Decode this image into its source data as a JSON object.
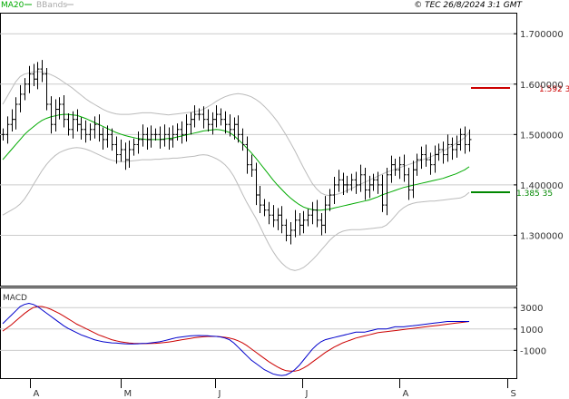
{
  "header": {
    "legend": [
      {
        "label": "MA20",
        "color": "#00aa00"
      },
      {
        "label": "BBands",
        "color": "#aaaaaa"
      }
    ],
    "copyright": "© TEC 26/8/2024 3:1 GMT"
  },
  "colors": {
    "price": "#000000",
    "ma20": "#00aa00",
    "bbands": "#bbbbbb",
    "resistance": "#cc0000",
    "support": "#008800",
    "macd": "#0000cc",
    "signal": "#cc0000",
    "grid": "#cccccc"
  },
  "chart_data": [
    {
      "type": "line",
      "title": "",
      "y_ticks": [
        "1.700000",
        "1.600000",
        "1.500000",
        "1.400000",
        "1.300000"
      ],
      "ylim": [
        1.2,
        1.74
      ],
      "x_ticks": [
        "A",
        "M",
        "J",
        "J",
        "A",
        "S"
      ],
      "levels": [
        {
          "name": "resistance",
          "value": 1.5923,
          "label": "1.592 3",
          "color": "#cc0000"
        },
        {
          "name": "support",
          "value": 1.38535,
          "label": "1.385 35",
          "color": "#008800"
        }
      ],
      "series": [
        {
          "key": "close",
          "values": [
            1.5,
            1.52,
            1.53,
            1.56,
            1.58,
            1.6,
            1.62,
            1.61,
            1.63,
            1.62,
            1.56,
            1.52,
            1.55,
            1.56,
            1.53,
            1.51,
            1.53,
            1.52,
            1.51,
            1.5,
            1.51,
            1.52,
            1.5,
            1.49,
            1.5,
            1.48,
            1.46,
            1.47,
            1.45,
            1.47,
            1.48,
            1.49,
            1.5,
            1.49,
            1.5,
            1.5,
            1.49,
            1.5,
            1.49,
            1.5,
            1.51,
            1.5,
            1.52,
            1.53,
            1.54,
            1.54,
            1.53,
            1.52,
            1.53,
            1.54,
            1.53,
            1.52,
            1.51,
            1.52,
            1.5,
            1.48,
            1.44,
            1.43,
            1.38,
            1.36,
            1.35,
            1.34,
            1.33,
            1.34,
            1.32,
            1.3,
            1.31,
            1.33,
            1.32,
            1.33,
            1.34,
            1.35,
            1.33,
            1.32,
            1.36,
            1.38,
            1.4,
            1.41,
            1.4,
            1.4,
            1.41,
            1.4,
            1.42,
            1.39,
            1.4,
            1.41,
            1.4,
            1.36,
            1.42,
            1.44,
            1.43,
            1.44,
            1.42,
            1.39,
            1.43,
            1.45,
            1.46,
            1.45,
            1.44,
            1.46,
            1.47,
            1.46,
            1.48,
            1.47,
            1.48,
            1.5,
            1.48,
            1.49
          ]
        },
        {
          "key": "ma20",
          "values": [
            1.45,
            1.46,
            1.47,
            1.48,
            1.49,
            1.5,
            1.508,
            1.515,
            1.522,
            1.528,
            1.532,
            1.535,
            1.537,
            1.539,
            1.54,
            1.54,
            1.539,
            1.538,
            1.535,
            1.532,
            1.528,
            1.524,
            1.52,
            1.516,
            1.512,
            1.508,
            1.504,
            1.501,
            1.498,
            1.496,
            1.494,
            1.492,
            1.491,
            1.49,
            1.49,
            1.49,
            1.49,
            1.491,
            1.492,
            1.493,
            1.495,
            1.497,
            1.499,
            1.501,
            1.503,
            1.505,
            1.507,
            1.508,
            1.509,
            1.51,
            1.509,
            1.507,
            1.504,
            1.498,
            1.49,
            1.482,
            1.473,
            1.464,
            1.454,
            1.443,
            1.432,
            1.421,
            1.41,
            1.4,
            1.391,
            1.382,
            1.374,
            1.367,
            1.361,
            1.356,
            1.353,
            1.351,
            1.35,
            1.35,
            1.351,
            1.352,
            1.354,
            1.356,
            1.358,
            1.36,
            1.362,
            1.364,
            1.366,
            1.368,
            1.37,
            1.373,
            1.376,
            1.38,
            1.383,
            1.386,
            1.389,
            1.392,
            1.395,
            1.397,
            1.399,
            1.401,
            1.403,
            1.405,
            1.407,
            1.409,
            1.411,
            1.413,
            1.416,
            1.419,
            1.422,
            1.426,
            1.43,
            1.436
          ]
        },
        {
          "key": "bb_upper",
          "values": [
            1.56,
            1.575,
            1.59,
            1.605,
            1.615,
            1.62,
            1.622,
            1.624,
            1.625,
            1.624,
            1.622,
            1.619,
            1.615,
            1.61,
            1.604,
            1.598,
            1.592,
            1.585,
            1.578,
            1.571,
            1.565,
            1.56,
            1.555,
            1.55,
            1.546,
            1.543,
            1.541,
            1.54,
            1.54,
            1.54,
            1.541,
            1.542,
            1.543,
            1.543,
            1.543,
            1.542,
            1.541,
            1.54,
            1.539,
            1.54,
            1.541,
            1.542,
            1.543,
            1.544,
            1.545,
            1.547,
            1.55,
            1.555,
            1.56,
            1.566,
            1.571,
            1.575,
            1.578,
            1.58,
            1.581,
            1.58,
            1.578,
            1.575,
            1.57,
            1.564,
            1.556,
            1.547,
            1.537,
            1.526,
            1.513,
            1.499,
            1.484,
            1.468,
            1.451,
            1.434,
            1.418,
            1.403,
            1.392,
            1.384,
            1.38,
            1.379,
            1.38,
            1.382,
            1.385,
            1.389,
            1.393,
            1.397,
            1.401,
            1.405,
            1.409,
            1.413,
            1.417,
            1.421,
            1.425,
            1.428,
            1.431,
            1.434,
            1.437,
            1.44,
            1.443,
            1.446,
            1.449,
            1.452,
            1.455,
            1.459,
            1.463,
            1.467,
            1.472,
            1.477,
            1.482,
            1.488,
            1.494,
            1.505
          ]
        },
        {
          "key": "bb_lower",
          "values": [
            1.34,
            1.345,
            1.35,
            1.355,
            1.362,
            1.372,
            1.385,
            1.4,
            1.414,
            1.428,
            1.44,
            1.45,
            1.458,
            1.464,
            1.468,
            1.471,
            1.473,
            1.474,
            1.473,
            1.471,
            1.468,
            1.464,
            1.46,
            1.456,
            1.452,
            1.449,
            1.447,
            1.446,
            1.446,
            1.447,
            1.448,
            1.449,
            1.45,
            1.45,
            1.45,
            1.451,
            1.451,
            1.452,
            1.452,
            1.453,
            1.453,
            1.454,
            1.455,
            1.456,
            1.457,
            1.459,
            1.46,
            1.459,
            1.456,
            1.452,
            1.447,
            1.44,
            1.43,
            1.417,
            1.4,
            1.382,
            1.365,
            1.35,
            1.335,
            1.318,
            1.3,
            1.283,
            1.268,
            1.255,
            1.245,
            1.237,
            1.232,
            1.23,
            1.232,
            1.236,
            1.243,
            1.251,
            1.26,
            1.27,
            1.28,
            1.29,
            1.298,
            1.304,
            1.308,
            1.31,
            1.311,
            1.311,
            1.311,
            1.312,
            1.313,
            1.314,
            1.315,
            1.316,
            1.32,
            1.328,
            1.338,
            1.348,
            1.355,
            1.36,
            1.363,
            1.365,
            1.366,
            1.367,
            1.368,
            1.368,
            1.369,
            1.37,
            1.371,
            1.372,
            1.373,
            1.374,
            1.378,
            1.385
          ]
        }
      ]
    },
    {
      "type": "line",
      "title": "MACD",
      "y_ticks": [
        "3000",
        "1000",
        "-1000"
      ],
      "ylim": [
        -3600,
        4800
      ],
      "series": [
        {
          "key": "macd",
          "values": [
            1500,
            1900,
            2300,
            2700,
            3100,
            3300,
            3400,
            3300,
            3100,
            2800,
            2500,
            2200,
            1900,
            1600,
            1300,
            1050,
            850,
            650,
            450,
            300,
            150,
            0,
            -100,
            -200,
            -250,
            -300,
            -320,
            -350,
            -380,
            -390,
            -400,
            -380,
            -360,
            -340,
            -300,
            -250,
            -200,
            -100,
            0,
            100,
            200,
            250,
            300,
            350,
            380,
            390,
            380,
            360,
            330,
            300,
            250,
            150,
            0,
            -300,
            -700,
            -1100,
            -1500,
            -1900,
            -2200,
            -2500,
            -2800,
            -3000,
            -3200,
            -3300,
            -3350,
            -3300,
            -3100,
            -2800,
            -2400,
            -1900,
            -1400,
            -900,
            -500,
            -200,
            0,
            100,
            200,
            300,
            400,
            500,
            600,
            700,
            700,
            700,
            800,
            900,
            1000,
            1000,
            1000,
            1100,
            1200,
            1200,
            1200,
            1250,
            1300,
            1350,
            1400,
            1450,
            1500,
            1550,
            1600,
            1650,
            1700,
            1700,
            1700,
            1700,
            1700,
            1700
          ]
        },
        {
          "key": "signal",
          "values": [
            800,
            1100,
            1400,
            1750,
            2100,
            2450,
            2750,
            3000,
            3100,
            3100,
            3000,
            2850,
            2650,
            2450,
            2200,
            1950,
            1700,
            1450,
            1250,
            1050,
            850,
            650,
            450,
            300,
            150,
            0,
            -100,
            -200,
            -260,
            -310,
            -340,
            -360,
            -370,
            -370,
            -360,
            -340,
            -310,
            -270,
            -220,
            -160,
            -90,
            -20,
            50,
            120,
            180,
            230,
            270,
            300,
            310,
            300,
            270,
            220,
            150,
            50,
            -100,
            -300,
            -550,
            -850,
            -1150,
            -1450,
            -1750,
            -2050,
            -2300,
            -2550,
            -2750,
            -2900,
            -2950,
            -2950,
            -2850,
            -2650,
            -2400,
            -2100,
            -1800,
            -1500,
            -1200,
            -950,
            -700,
            -500,
            -300,
            -150,
            0,
            150,
            250,
            350,
            450,
            550,
            650,
            700,
            750,
            800,
            850,
            900,
            950,
            1000,
            1050,
            1100,
            1150,
            1200,
            1250,
            1300,
            1350,
            1400,
            1450,
            1500,
            1550,
            1600,
            1650,
            1700
          ]
        }
      ]
    }
  ]
}
